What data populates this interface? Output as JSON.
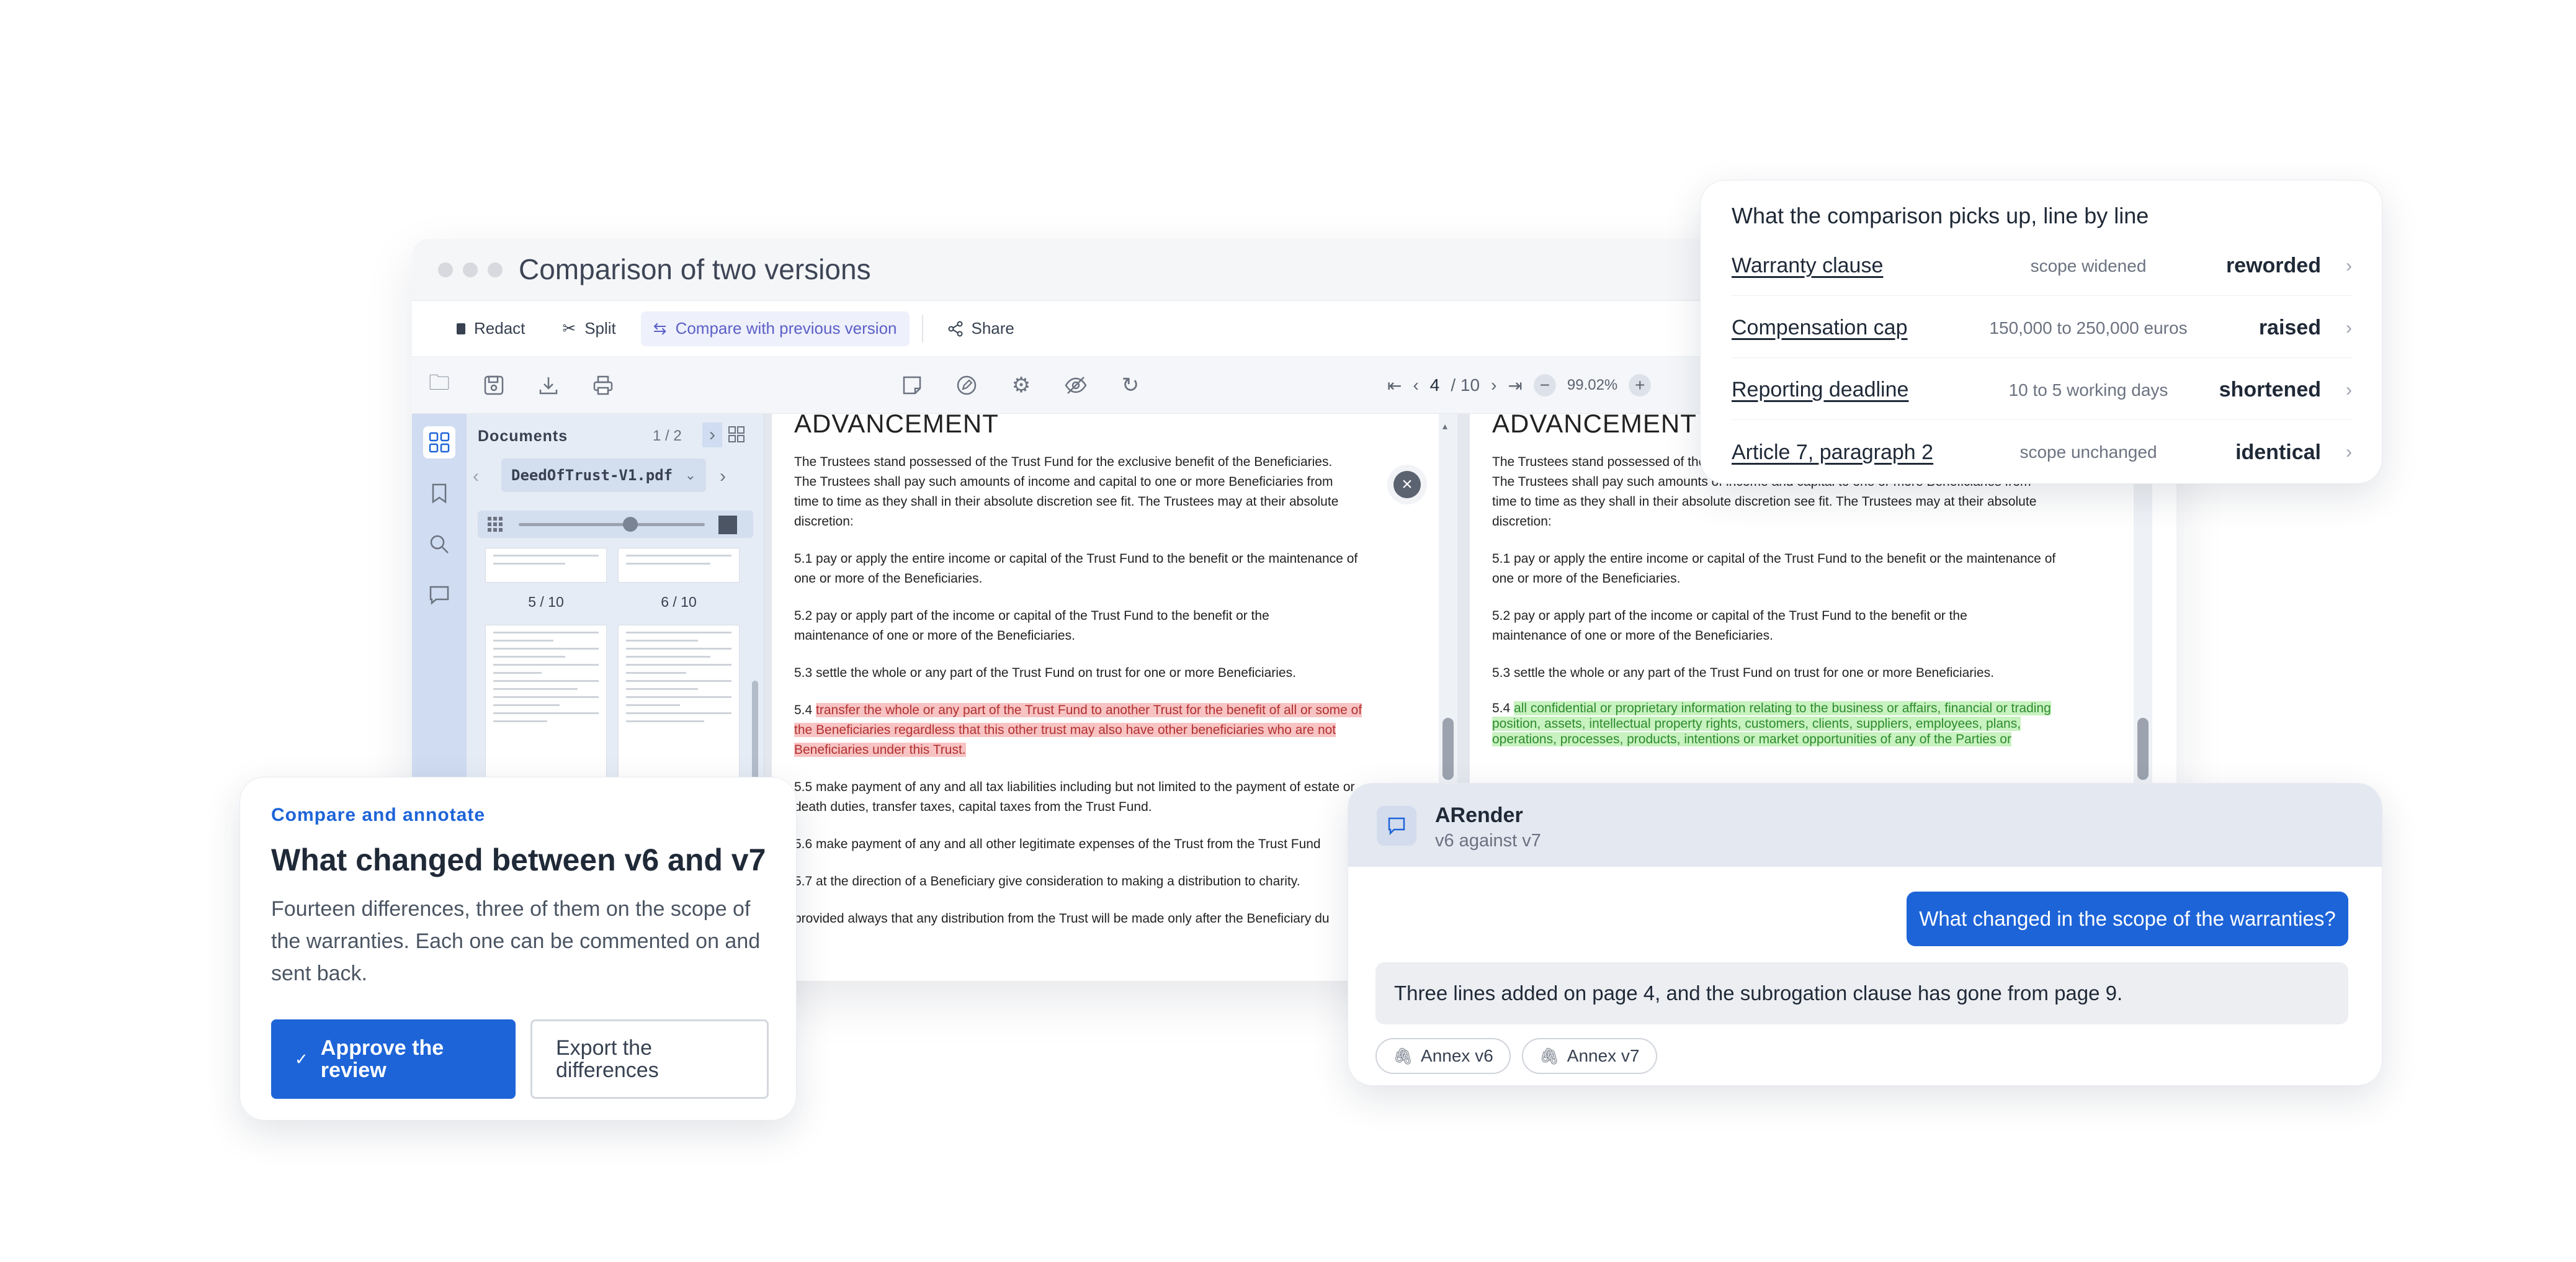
{
  "window": {
    "title": "Comparison of two versions",
    "actions": {
      "redact": "Redact",
      "split": "Split",
      "compare": "Compare with previous version",
      "share": "Share"
    },
    "page_current": "4",
    "page_total": "/ 10",
    "zoom": "99.02%"
  },
  "sidebar": {
    "panel_title": "Documents",
    "doc_count": "1 / 2",
    "file_name": "DeedOfTrust-V1.pdf",
    "thumb_labels": [
      "5 / 10",
      "6 / 10"
    ],
    "zoom_slider": 0.6
  },
  "left_doc": {
    "heading": "ADVANCEMENT",
    "p1": "The Trustees stand possessed of the Trust Fund for the exclusive benefit of the Beneficiaries. The Trustees shall pay such amounts of income and capital to one or more Beneficiaries from time to time as they shall in their absolute discretion see fit. The Trustees may at their absolute discretion:",
    "p51": "5.1 pay or apply the entire income or capital of the Trust Fund to the benefit or the maintenance of one or more of the Beneficiaries.",
    "p52": "5.2 pay or apply part of the income or capital of the Trust Fund to the benefit or the maintenance of one or more of the Beneficiaries.",
    "p53": "5.3 settle the whole or any part of the Trust Fund on trust for one or more Beneficiaries.",
    "p54_prefix": "5.4 ",
    "p54_del": "transfer the whole or any part of the Trust Fund to another Trust for the benefit of all or some of the Beneficiaries regardless that this other trust may also have other beneficiaries who are not Beneficiaries under this Trust.",
    "p55": "5.5 make payment of any and all tax liabilities including but not limited to the payment of estate or death duties, transfer taxes, capital taxes from the Trust Fund.",
    "p56": "5.6 make payment of any and all other legitimate expenses of the Trust from the Trust Fund",
    "p57": "5.7 at the direction of a Beneficiary give consideration to making a distribution to  charity.",
    "p58": "provided always that any distribution from the Trust will be made only after the Beneficiary du"
  },
  "right_doc": {
    "heading": "ADVANCEMENT",
    "p1": "The Trustees stand possessed of the Trust Fund for the exclusive benefit of the Beneficiaries. The Trustees shall pay such amounts of income and capital to one or more Beneficiaries from time to time as they shall in their absolute discretion see fit. The Trustees may at their absolute discretion:",
    "p51": "5.1 pay or apply the entire income or capital of the Trust Fund to the benefit or the maintenance of one or more of the Beneficiaries.",
    "p52": "5.2 pay or apply part of the income or capital of the Trust Fund to the benefit or the maintenance of one or more of the Beneficiaries.",
    "p53": "5.3 settle the whole or any part of the Trust Fund on trust for one or more Beneficiaries.",
    "p54_prefix": "5.4 ",
    "p54_ins": "all confidential or proprietary information relating to the business or affairs, financial or trading position, assets, intellectual property rights, customers, clients, suppliers, employees, plans, operations, processes, products, intentions or market opportunities of any of the Parties or"
  },
  "comparison": {
    "title": "What the comparison picks up, line by line",
    "rows": [
      {
        "label": "Warranty clause",
        "detail": "scope widened",
        "status": "reworded"
      },
      {
        "label": "Compensation cap",
        "detail": "150,000 to 250,000 euros",
        "status": "raised"
      },
      {
        "label": "Reporting deadline",
        "detail": "10 to 5 working days",
        "status": "shortened"
      },
      {
        "label": "Article 7, paragraph 2",
        "detail": "scope unchanged",
        "status": "identical"
      }
    ]
  },
  "annotate": {
    "eyebrow": "Compare and annotate",
    "title": "What changed between v6 and v7",
    "body": "Fourteen differences, three of them on the scope of the warranties. Each one can be commented on and sent back.",
    "approve": "Approve the review",
    "export": "Export the differences"
  },
  "chat": {
    "name": "ARender",
    "subtitle": "v6 against v7",
    "user_msg": "What changed in the scope of the warranties?",
    "bot_msg": "Three lines added on page 4, and the subrogation clause has gone from page 9.",
    "chips": [
      "Annex v6",
      "Annex v7"
    ]
  },
  "colors": {
    "primary": "#1d64d8",
    "accent": "#5b5fc7",
    "deletion": "#f8c3c3",
    "insertion": "#c8f2c0",
    "sidebar": "#cfdcf1"
  }
}
